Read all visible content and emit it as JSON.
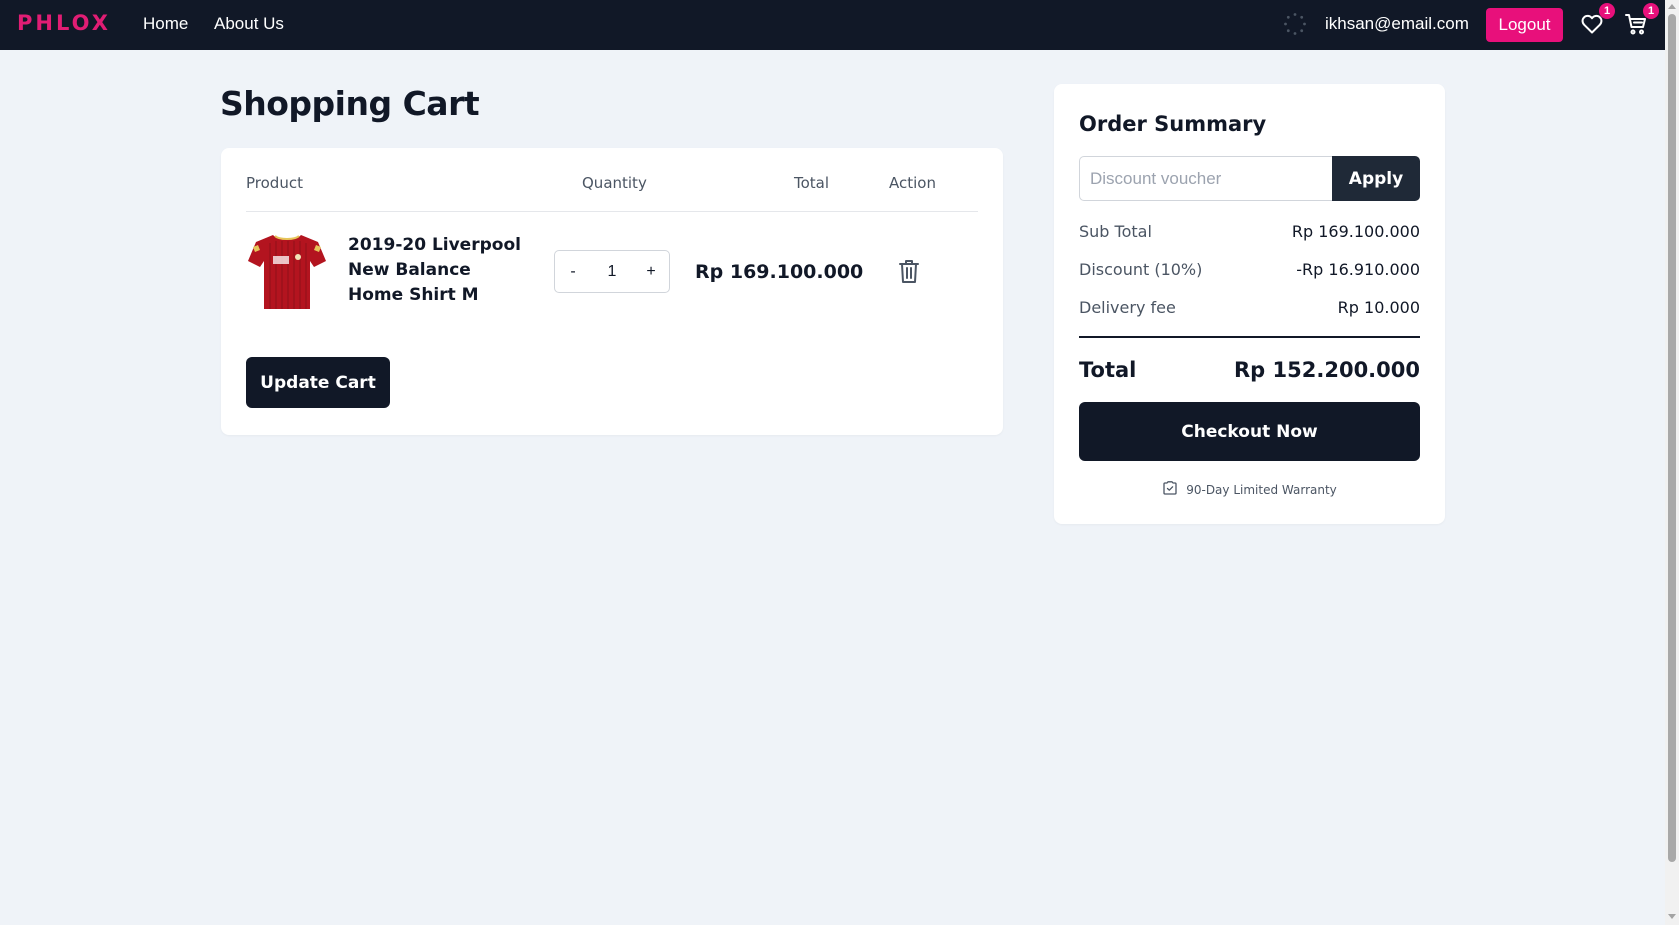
{
  "navbar": {
    "brand": "PHLOX",
    "links": [
      "Home",
      "About Us"
    ],
    "user_email": "ikhsan@email.com",
    "logout_label": "Logout",
    "wishlist_count": "1",
    "cart_count": "1",
    "icons": [
      "loading-spinner-icon",
      "heart-icon",
      "cart-icon"
    ]
  },
  "page": {
    "title": "Shopping Cart"
  },
  "cart_table": {
    "headers": [
      "Product",
      "Quantity",
      "Total",
      "Action"
    ],
    "items": [
      {
        "name": "2019-20 Liverpool New Balance Home Shirt M",
        "quantity": "1",
        "decrement_label": "-",
        "increment_label": "+",
        "total": "Rp 169.100.000",
        "image": "red-football-shirt"
      }
    ],
    "update_label": "Update Cart"
  },
  "summary": {
    "title": "Order Summary",
    "voucher_placeholder": "Discount voucher",
    "apply_label": "Apply",
    "sub_total_label": "Sub Total",
    "sub_total": "Rp 169.100.000",
    "discount_label": "Discount (10%)",
    "discount": "-Rp 16.910.000",
    "delivery_label": "Delivery fee",
    "delivery": "Rp 10.000",
    "total_label": "Total",
    "total": "Rp 152.200.000",
    "checkout_label": "Checkout Now",
    "warranty_text": "90-Day Limited Warranty"
  },
  "colors": {
    "navbar_bg": "#111827",
    "brand": "#e11d74",
    "accent_pink": "#e8107b",
    "page_bg": "#eff3f8",
    "dark_button": "#111827"
  }
}
